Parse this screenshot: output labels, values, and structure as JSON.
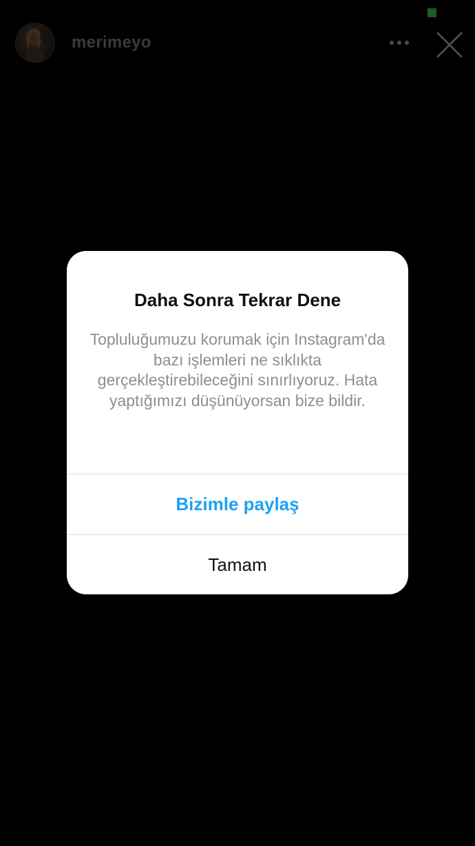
{
  "story_header": {
    "username": "merimeyo",
    "avatar_icon": "profile-photo",
    "more_icon": "more-horizontal-icon",
    "close_icon": "close-icon"
  },
  "status_indicator_color": "#1e5a2a",
  "dialog": {
    "title": "Daha Sonra Tekrar Dene",
    "message": "Topluluğumuzu korumak için Instagram'da bazı işlemleri ne sıklıkta gerçekleştirebileceğini sınırlıyoruz. Hata yaptığımızı düşünüyorsan bize bildir.",
    "primary_button": "Bizimle paylaş",
    "secondary_button": "Tamam",
    "primary_color": "#1da1f2"
  }
}
